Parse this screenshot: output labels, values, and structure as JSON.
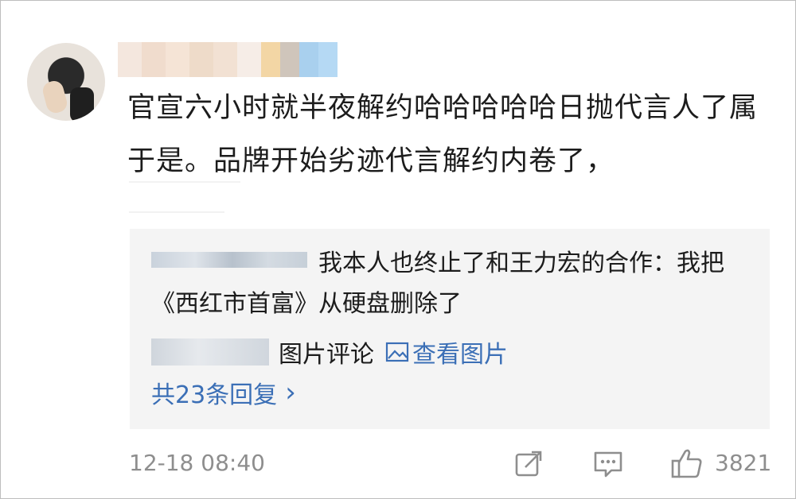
{
  "post": {
    "text": "官宣六小时就半夜解约哈哈哈哈哈日抛代言人了属于是。品牌开始劣迹代言解约内卷了，"
  },
  "reply": {
    "text": "我本人也终止了和王力宏的合作：我把《西红市首富》从硬盘删除了",
    "image_label": "图片评论",
    "view_image_label": "查看图片",
    "replies_label": "共23条回复",
    "replies_chevron": "›"
  },
  "footer": {
    "timestamp": "12-18 08:40",
    "like_count": "3821"
  },
  "icons": [
    "share-icon",
    "comment-icon",
    "like-icon",
    "picture-icon"
  ],
  "colors": {
    "link": "#3b6fb6",
    "meta": "#8e8e8e",
    "card": "#f4f4f4"
  }
}
